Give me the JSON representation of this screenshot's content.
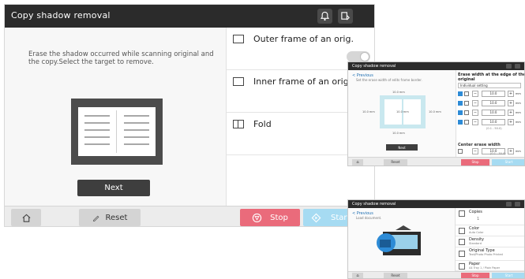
{
  "main": {
    "title": "Copy shadow removal",
    "description": "Erase the shadow occurred while scanning original and the copy.Select the target to remove.",
    "next_label": "Next",
    "options": [
      {
        "label": "Outer frame of an orig."
      },
      {
        "label": "Inner frame of an orig"
      },
      {
        "label": "Fold"
      }
    ],
    "footer": {
      "reset_label": "Reset",
      "stop_label": "Stop",
      "start_label": "Start"
    },
    "colors": {
      "stop": "#ea6b7b",
      "start": "#a6dbf2",
      "titlebar": "#2b2b2b"
    }
  },
  "mini1": {
    "title": "Copy shadow removal",
    "previous_label": "< Previous",
    "subtitle": "Set the erase width of edits frame border.",
    "frame_labels": {
      "top": "10.0 mm",
      "left": "10.0 mm",
      "center": "10.0 mm",
      "right": "10.0 mm",
      "bottom": "10.0 mm"
    },
    "next_label": "Next",
    "heading": "Erase width at the edge of the original",
    "setting": "Individual setting",
    "rows": [
      {
        "value": "10.0",
        "unit": "mm"
      },
      {
        "value": "10.0",
        "unit": "mm"
      },
      {
        "value": "10.0",
        "unit": "mm"
      },
      {
        "value": "10.0",
        "unit": "mm"
      }
    ],
    "range": "(0.1 - 50.0)",
    "center_heading": "Center erase width",
    "center_value": "10.0",
    "center_unit": "mm",
    "center_range": "(0.1 - 30.0)",
    "footer": {
      "reset_label": "Reset",
      "stop_label": "Stop",
      "start_label": "Start"
    }
  },
  "mini2": {
    "title": "Copy shadow removal",
    "previous_label": "< Previous",
    "subtitle": "Load document.",
    "items": [
      {
        "title": "Copies",
        "sub": "1"
      },
      {
        "title": "Color",
        "sub": "Auto Color"
      },
      {
        "title": "Density",
        "sub": "Standard"
      },
      {
        "title": "Original Type",
        "sub": "Text/Photo Photo Printed"
      },
      {
        "title": "Paper",
        "sub": "A4  Tray 1 / Plain Paper"
      }
    ],
    "footer": {
      "reset_label": "Reset",
      "stop_label": "Stop",
      "start_label": "Start"
    }
  }
}
